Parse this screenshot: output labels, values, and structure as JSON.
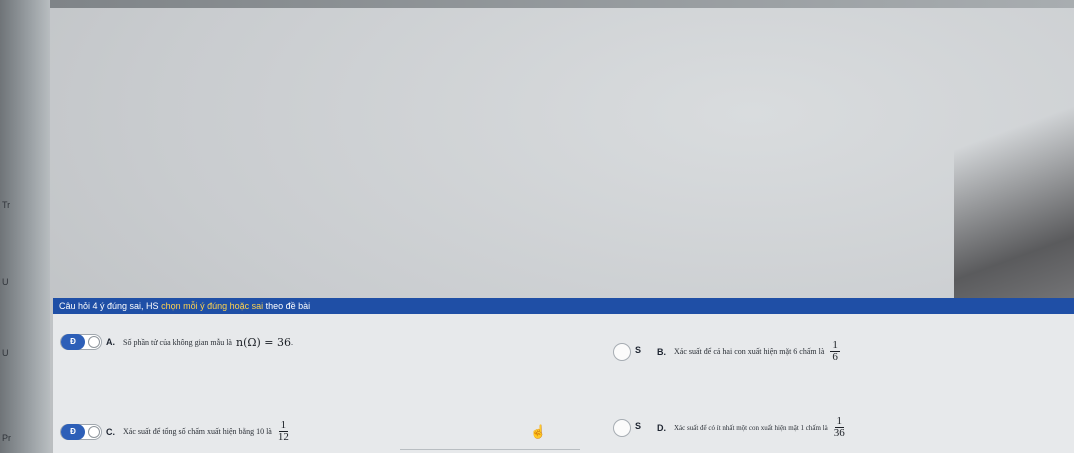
{
  "header": {
    "prefix": "Câu hỏi 4 ý đúng sai, HS ",
    "highlight": "chọn mỗi ý đúng hoặc sai",
    "suffix": " theo đề bài"
  },
  "items": [
    {
      "letter": "A.",
      "answer": "Đ",
      "text": "Số phần tử của không gian mẫu là",
      "math": "n(Ω) = 36",
      "math_suffix": "."
    },
    {
      "letter": "B.",
      "answer": "S",
      "text": "Xác suất để cả hai con xuất hiện mặt 6 chấm là",
      "frac_num": "1",
      "frac_den": "6"
    },
    {
      "letter": "C.",
      "answer": "Đ",
      "text": "Xác suất để tổng số chấm xuất hiện bằng 10 là",
      "frac_num": "1",
      "frac_den": "12"
    },
    {
      "letter": "D.",
      "answer": "S",
      "text": "Xác suất để có ít nhất một con xuất hiện mặt 1 chấm là",
      "frac_num": "1",
      "frac_den": "36"
    }
  ],
  "edge_letters": [
    "Tr",
    "U",
    "U",
    "Pr"
  ],
  "colors": {
    "header_bg": "#1f4fa6",
    "highlight": "#ffd34d",
    "toggle_active": "#2d5fb8"
  },
  "icons": {
    "cursor": "hand-pointer-icon"
  }
}
